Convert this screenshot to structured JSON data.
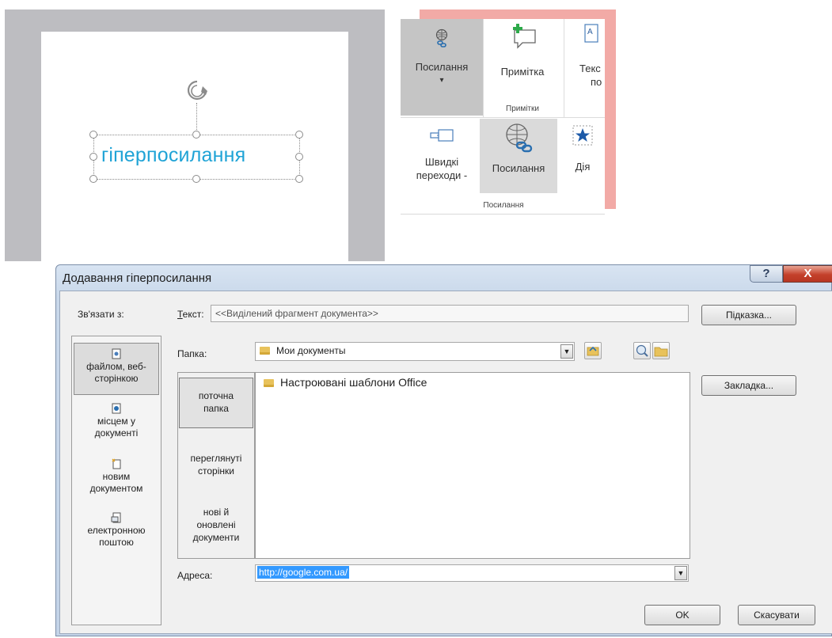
{
  "slide": {
    "selected_text": "гіперпосилання"
  },
  "ribbon": {
    "btn_link_top": "Посилання",
    "btn_link_top_arrow": "▾",
    "btn_note": "Примітка",
    "btn_text_partial_1": "Текс",
    "btn_text_partial_2": "по",
    "group_notes": "Примітки",
    "btn_quick_1": "Швидкі",
    "btn_quick_2": "переходи -",
    "btn_link_bottom": "Посилання",
    "btn_action": "Дія",
    "group_links": "Посилання"
  },
  "dialog": {
    "title": "Додавання гіперпосилання",
    "help_glyph": "?",
    "close_glyph": "X",
    "link_to_label": "Зв'язати з:",
    "text_label": "Текст:",
    "text_value": "<<Виділений фрагмент документа>>",
    "hint_button": "Підказка...",
    "folder_label": "Папка:",
    "folder_value": "Мои документы",
    "bookmark_button": "Закладка...",
    "link_items": [
      {
        "line1": "файлом, веб-",
        "line2": "сторінкою"
      },
      {
        "line1": "місцем у",
        "line2": "документі"
      },
      {
        "line1": "новим",
        "line2": "документом"
      },
      {
        "line1": "електронною",
        "line2": "поштою"
      }
    ],
    "tabs": [
      {
        "line1": "поточна",
        "line2": "папка",
        "line3": ""
      },
      {
        "line1": "переглянуті",
        "line2": "сторінки",
        "line3": ""
      },
      {
        "line1": "нові й",
        "line2": "оновлені",
        "line3": "документи"
      }
    ],
    "files": [
      "Настроювані шаблони Office"
    ],
    "address_label": "Адреса:",
    "address_value": "http://google.com.ua/",
    "ok_button": "OK",
    "cancel_button": "Скасувати"
  },
  "colors": {
    "hyperlink_text": "#1fa3d6",
    "ribbon_accent_shadow": "#f2aaa6",
    "close_button": "#c4412b"
  }
}
